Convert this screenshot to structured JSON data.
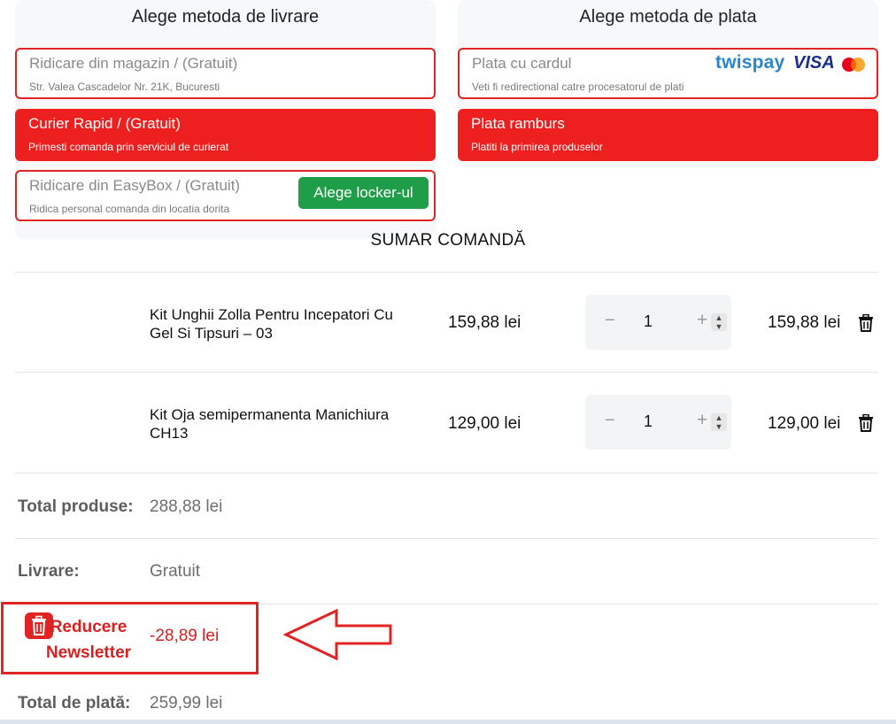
{
  "delivery": {
    "title": "Alege metoda de livrare",
    "options": [
      {
        "label": "Ridicare din magazin / (Gratuit)",
        "sub": "Str. Valea Cascadelor Nr. 21K, Bucuresti"
      },
      {
        "label": "Curier Rapid / (Gratuit)",
        "sub": "Primesti comanda prin serviciul de curierat"
      },
      {
        "label": "Ridicare din EasyBox / (Gratuit)",
        "sub": "Ridica personal comanda din locatia dorita",
        "button": "Alege locker-ul"
      }
    ]
  },
  "payment": {
    "title": "Alege metoda de plata",
    "options": [
      {
        "label": "Plata cu cardul",
        "sub": "Veti fi redirectional catre procesatorul de plati",
        "logos": [
          "twispay",
          "VISA",
          "mastercard"
        ]
      },
      {
        "label": "Plata ramburs",
        "sub": "Platiti la primirea produselor"
      }
    ]
  },
  "summary": {
    "title": "SUMAR COMANDĂ",
    "products": [
      {
        "name": "Kit Unghii Zolla Pentru Incepatori Cu Gel Si Tipsuri – 03",
        "price": "159,88 lei",
        "qty": "1",
        "minus": "−",
        "plus": "+",
        "total": "159,88 lei"
      },
      {
        "name": "Kit Oja semipermanenta Manichiura CH13",
        "price": "129,00 lei",
        "qty": "1",
        "minus": "−",
        "plus": "+",
        "total": "129,00 lei"
      }
    ],
    "total_products_label": "Total produse:",
    "total_products_value": "288,88 lei",
    "delivery_label": "Livrare:",
    "delivery_value": "Gratuit",
    "discount_label": "Reducere Newsletter",
    "discount_value": "-28,89 lei",
    "total_pay_label": "Total de plată:",
    "total_pay_value": "259,99 lei"
  },
  "colors": {
    "accent_red": "#ee1f1f",
    "button_green": "#1e9e48"
  },
  "icons": {
    "trash": "trash-icon",
    "discount_remove": "trash-icon",
    "annotation": "arrow-left-icon"
  }
}
